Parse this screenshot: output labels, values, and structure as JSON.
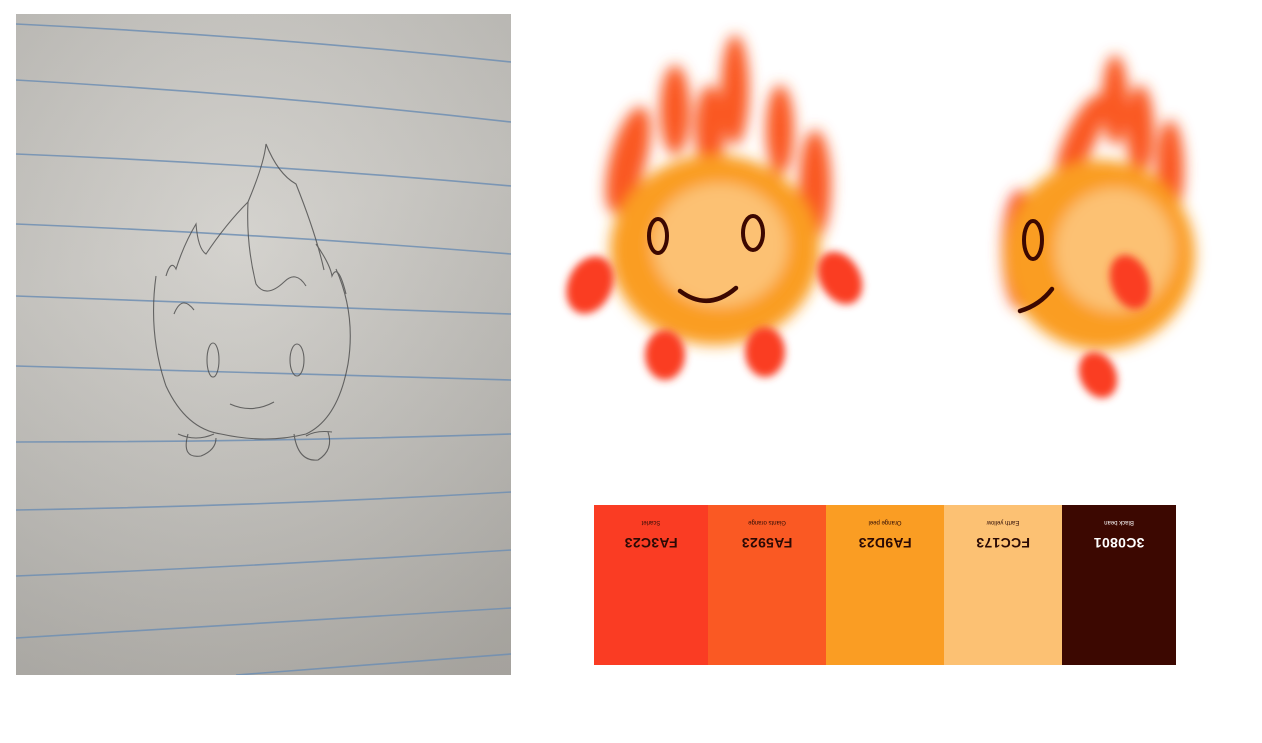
{
  "sketch": {
    "subject": "pencil-sketch-fire-creature-photo"
  },
  "characters": [
    {
      "name": "fire-creature-front"
    },
    {
      "name": "fire-creature-side"
    }
  ],
  "palette": {
    "swatches": [
      {
        "hex": "FA3C23",
        "name": "Scarlet",
        "color": "#FA3C23",
        "text_color": "#2b0a05"
      },
      {
        "hex": "FA5923",
        "name": "Giants orange",
        "color": "#FA5923",
        "text_color": "#2b0a05"
      },
      {
        "hex": "FA9D23",
        "name": "Orange peel",
        "color": "#FA9D23",
        "text_color": "#2b0a05"
      },
      {
        "hex": "FCC173",
        "name": "Earth yellow",
        "color": "#FCC173",
        "text_color": "#2b0a05"
      },
      {
        "hex": "3C0801",
        "name": "Black bean",
        "color": "#3C0801",
        "text_color": "#ffffff"
      }
    ]
  }
}
